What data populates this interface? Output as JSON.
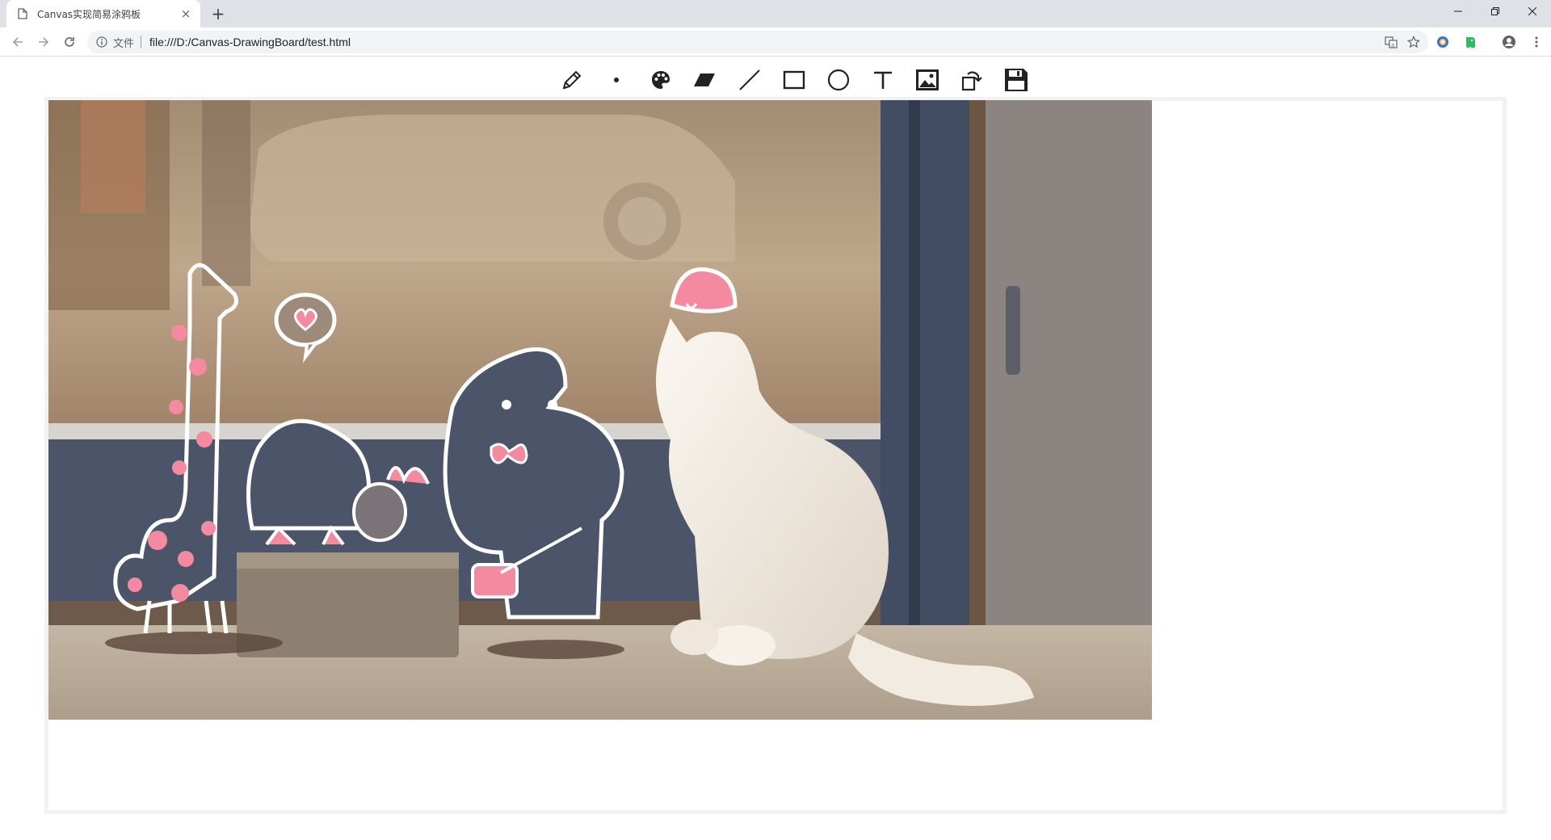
{
  "browser": {
    "tab_title": "Canvas实现简易涂鸦板",
    "tab_close": "×",
    "new_tab": "+",
    "scheme_label": "文件",
    "url": "file:///D:/Canvas-DrawingBoard/test.html"
  },
  "tools": [
    {
      "icon": "pencil-icon"
    },
    {
      "icon": "brush-size-dot-icon"
    },
    {
      "icon": "palette-icon"
    },
    {
      "icon": "eraser-icon"
    },
    {
      "icon": "line-icon"
    },
    {
      "icon": "rectangle-icon"
    },
    {
      "icon": "circle-icon"
    },
    {
      "icon": "text-icon"
    },
    {
      "icon": "image-icon"
    },
    {
      "icon": "undo-rotate-icon"
    },
    {
      "icon": "save-icon"
    }
  ],
  "canvas": {
    "image_subject": "white cat looking at cartoon animal doodles on shop window"
  },
  "colors": {
    "tab_strip": "#dee1e6",
    "omnibox": "#f1f3f4",
    "board_border": "#f2f2f2",
    "doodle_pink": "#f48aa0",
    "door_blue": "#424c63"
  }
}
